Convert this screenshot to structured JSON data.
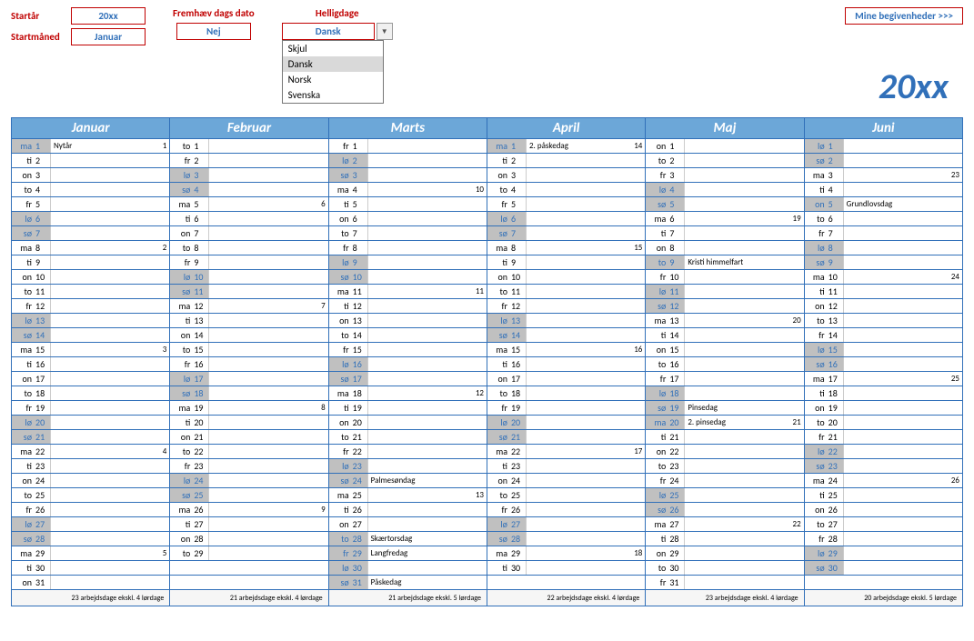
{
  "controls": {
    "start_year_label": "Startår",
    "start_year_value": "20xx",
    "start_month_label": "Startmåned",
    "start_month_value": "Januar",
    "highlight_label": "Fremhæv dags dato",
    "highlight_value": "Nej",
    "holidays_label": "Helligdage",
    "holidays_value": "Dansk",
    "holidays_options": [
      "Skjul",
      "Dansk",
      "Norsk",
      "Svenska"
    ],
    "holidays_selected_index": 1,
    "events_link": "Mine begivenheder >>>"
  },
  "year_display": "20xx",
  "months": [
    {
      "name": "Januar",
      "footer": "23 arbejdsdage ekskl. 4 lørdage",
      "days": [
        {
          "wd": "ma",
          "n": 1,
          "evt": "Nytår",
          "wk": 1,
          "hol": true
        },
        {
          "wd": "ti",
          "n": 2
        },
        {
          "wd": "on",
          "n": 3
        },
        {
          "wd": "to",
          "n": 4
        },
        {
          "wd": "fr",
          "n": 5
        },
        {
          "wd": "lø",
          "n": 6,
          "wknd": true
        },
        {
          "wd": "sø",
          "n": 7,
          "wknd": true
        },
        {
          "wd": "ma",
          "n": 8,
          "wk": 2
        },
        {
          "wd": "ti",
          "n": 9
        },
        {
          "wd": "on",
          "n": 10
        },
        {
          "wd": "to",
          "n": 11
        },
        {
          "wd": "fr",
          "n": 12
        },
        {
          "wd": "lø",
          "n": 13,
          "wknd": true
        },
        {
          "wd": "sø",
          "n": 14,
          "wknd": true
        },
        {
          "wd": "ma",
          "n": 15,
          "wk": 3
        },
        {
          "wd": "ti",
          "n": 16
        },
        {
          "wd": "on",
          "n": 17
        },
        {
          "wd": "to",
          "n": 18
        },
        {
          "wd": "fr",
          "n": 19
        },
        {
          "wd": "lø",
          "n": 20,
          "wknd": true
        },
        {
          "wd": "sø",
          "n": 21,
          "wknd": true
        },
        {
          "wd": "ma",
          "n": 22,
          "wk": 4
        },
        {
          "wd": "ti",
          "n": 23
        },
        {
          "wd": "on",
          "n": 24
        },
        {
          "wd": "to",
          "n": 25
        },
        {
          "wd": "fr",
          "n": 26
        },
        {
          "wd": "lø",
          "n": 27,
          "wknd": true
        },
        {
          "wd": "sø",
          "n": 28,
          "wknd": true
        },
        {
          "wd": "ma",
          "n": 29,
          "wk": 5
        },
        {
          "wd": "ti",
          "n": 30
        },
        {
          "wd": "on",
          "n": 31
        }
      ]
    },
    {
      "name": "Februar",
      "footer": "21 arbejdsdage ekskl. 4 lørdage",
      "days": [
        {
          "wd": "to",
          "n": 1
        },
        {
          "wd": "fr",
          "n": 2
        },
        {
          "wd": "lø",
          "n": 3,
          "wknd": true
        },
        {
          "wd": "sø",
          "n": 4,
          "wknd": true
        },
        {
          "wd": "ma",
          "n": 5,
          "wk": 6
        },
        {
          "wd": "ti",
          "n": 6
        },
        {
          "wd": "on",
          "n": 7
        },
        {
          "wd": "to",
          "n": 8
        },
        {
          "wd": "fr",
          "n": 9
        },
        {
          "wd": "lø",
          "n": 10,
          "wknd": true
        },
        {
          "wd": "sø",
          "n": 11,
          "wknd": true
        },
        {
          "wd": "ma",
          "n": 12,
          "wk": 7
        },
        {
          "wd": "ti",
          "n": 13
        },
        {
          "wd": "on",
          "n": 14
        },
        {
          "wd": "to",
          "n": 15
        },
        {
          "wd": "fr",
          "n": 16
        },
        {
          "wd": "lø",
          "n": 17,
          "wknd": true
        },
        {
          "wd": "sø",
          "n": 18,
          "wknd": true
        },
        {
          "wd": "ma",
          "n": 19,
          "wk": 8
        },
        {
          "wd": "ti",
          "n": 20
        },
        {
          "wd": "on",
          "n": 21
        },
        {
          "wd": "to",
          "n": 22
        },
        {
          "wd": "fr",
          "n": 23
        },
        {
          "wd": "lø",
          "n": 24,
          "wknd": true
        },
        {
          "wd": "sø",
          "n": 25,
          "wknd": true
        },
        {
          "wd": "ma",
          "n": 26,
          "wk": 9
        },
        {
          "wd": "ti",
          "n": 27
        },
        {
          "wd": "on",
          "n": 28
        },
        {
          "wd": "to",
          "n": 29
        }
      ]
    },
    {
      "name": "Marts",
      "footer": "21 arbejdsdage ekskl. 5 lørdage",
      "days": [
        {
          "wd": "fr",
          "n": 1
        },
        {
          "wd": "lø",
          "n": 2,
          "wknd": true
        },
        {
          "wd": "sø",
          "n": 3,
          "wknd": true
        },
        {
          "wd": "ma",
          "n": 4,
          "wk": 10
        },
        {
          "wd": "ti",
          "n": 5
        },
        {
          "wd": "on",
          "n": 6
        },
        {
          "wd": "to",
          "n": 7
        },
        {
          "wd": "fr",
          "n": 8
        },
        {
          "wd": "lø",
          "n": 9,
          "wknd": true
        },
        {
          "wd": "sø",
          "n": 10,
          "wknd": true
        },
        {
          "wd": "ma",
          "n": 11,
          "wk": 11
        },
        {
          "wd": "ti",
          "n": 12
        },
        {
          "wd": "on",
          "n": 13
        },
        {
          "wd": "to",
          "n": 14
        },
        {
          "wd": "fr",
          "n": 15
        },
        {
          "wd": "lø",
          "n": 16,
          "wknd": true
        },
        {
          "wd": "sø",
          "n": 17,
          "wknd": true
        },
        {
          "wd": "ma",
          "n": 18,
          "wk": 12
        },
        {
          "wd": "ti",
          "n": 19
        },
        {
          "wd": "on",
          "n": 20
        },
        {
          "wd": "to",
          "n": 21
        },
        {
          "wd": "fr",
          "n": 22
        },
        {
          "wd": "lø",
          "n": 23,
          "wknd": true
        },
        {
          "wd": "sø",
          "n": 24,
          "wknd": true,
          "evt": "Palmesøndag"
        },
        {
          "wd": "ma",
          "n": 25,
          "wk": 13
        },
        {
          "wd": "ti",
          "n": 26
        },
        {
          "wd": "on",
          "n": 27
        },
        {
          "wd": "to",
          "n": 28,
          "evt": "Skærtorsdag",
          "hol": true
        },
        {
          "wd": "fr",
          "n": 29,
          "evt": "Langfredag",
          "hol": true
        },
        {
          "wd": "lø",
          "n": 30,
          "wknd": true
        },
        {
          "wd": "sø",
          "n": 31,
          "wknd": true,
          "evt": "Påskedag"
        }
      ]
    },
    {
      "name": "April",
      "footer": "22 arbejdsdage ekskl. 4 lørdage",
      "days": [
        {
          "wd": "ma",
          "n": 1,
          "evt": "2. påskedag",
          "wk": 14,
          "hol": true
        },
        {
          "wd": "ti",
          "n": 2
        },
        {
          "wd": "on",
          "n": 3
        },
        {
          "wd": "to",
          "n": 4
        },
        {
          "wd": "fr",
          "n": 5
        },
        {
          "wd": "lø",
          "n": 6,
          "wknd": true
        },
        {
          "wd": "sø",
          "n": 7,
          "wknd": true
        },
        {
          "wd": "ma",
          "n": 8,
          "wk": 15
        },
        {
          "wd": "ti",
          "n": 9
        },
        {
          "wd": "on",
          "n": 10
        },
        {
          "wd": "to",
          "n": 11
        },
        {
          "wd": "fr",
          "n": 12
        },
        {
          "wd": "lø",
          "n": 13,
          "wknd": true
        },
        {
          "wd": "sø",
          "n": 14,
          "wknd": true
        },
        {
          "wd": "ma",
          "n": 15,
          "wk": 16
        },
        {
          "wd": "ti",
          "n": 16
        },
        {
          "wd": "on",
          "n": 17
        },
        {
          "wd": "to",
          "n": 18
        },
        {
          "wd": "fr",
          "n": 19
        },
        {
          "wd": "lø",
          "n": 20,
          "wknd": true
        },
        {
          "wd": "sø",
          "n": 21,
          "wknd": true
        },
        {
          "wd": "ma",
          "n": 22,
          "wk": 17
        },
        {
          "wd": "ti",
          "n": 23
        },
        {
          "wd": "on",
          "n": 24
        },
        {
          "wd": "to",
          "n": 25
        },
        {
          "wd": "fr",
          "n": 26
        },
        {
          "wd": "lø",
          "n": 27,
          "wknd": true
        },
        {
          "wd": "sø",
          "n": 28,
          "wknd": true
        },
        {
          "wd": "ma",
          "n": 29,
          "wk": 18
        },
        {
          "wd": "ti",
          "n": 30
        }
      ]
    },
    {
      "name": "Maj",
      "footer": "23 arbejdsdage ekskl. 4 lørdage",
      "days": [
        {
          "wd": "on",
          "n": 1
        },
        {
          "wd": "to",
          "n": 2
        },
        {
          "wd": "fr",
          "n": 3
        },
        {
          "wd": "lø",
          "n": 4,
          "wknd": true
        },
        {
          "wd": "sø",
          "n": 5,
          "wknd": true
        },
        {
          "wd": "ma",
          "n": 6,
          "wk": 19
        },
        {
          "wd": "ti",
          "n": 7
        },
        {
          "wd": "on",
          "n": 8
        },
        {
          "wd": "to",
          "n": 9,
          "evt": "Kristi himmelfart",
          "hol": true
        },
        {
          "wd": "fr",
          "n": 10
        },
        {
          "wd": "lø",
          "n": 11,
          "wknd": true
        },
        {
          "wd": "sø",
          "n": 12,
          "wknd": true
        },
        {
          "wd": "ma",
          "n": 13,
          "wk": 20
        },
        {
          "wd": "ti",
          "n": 14
        },
        {
          "wd": "on",
          "n": 15
        },
        {
          "wd": "to",
          "n": 16
        },
        {
          "wd": "fr",
          "n": 17
        },
        {
          "wd": "lø",
          "n": 18,
          "wknd": true
        },
        {
          "wd": "sø",
          "n": 19,
          "wknd": true,
          "evt": "Pinsedag"
        },
        {
          "wd": "ma",
          "n": 20,
          "evt": "2. pinsedag",
          "wk": 21,
          "hol": true
        },
        {
          "wd": "ti",
          "n": 21
        },
        {
          "wd": "on",
          "n": 22
        },
        {
          "wd": "to",
          "n": 23
        },
        {
          "wd": "fr",
          "n": 24
        },
        {
          "wd": "lø",
          "n": 25,
          "wknd": true
        },
        {
          "wd": "sø",
          "n": 26,
          "wknd": true
        },
        {
          "wd": "ma",
          "n": 27,
          "wk": 22
        },
        {
          "wd": "ti",
          "n": 28
        },
        {
          "wd": "on",
          "n": 29
        },
        {
          "wd": "to",
          "n": 30
        },
        {
          "wd": "fr",
          "n": 31
        }
      ]
    },
    {
      "name": "Juni",
      "footer": "20 arbejdsdage ekskl. 5 lørdage",
      "days": [
        {
          "wd": "lø",
          "n": 1,
          "wknd": true
        },
        {
          "wd": "sø",
          "n": 2,
          "wknd": true
        },
        {
          "wd": "ma",
          "n": 3,
          "wk": 23
        },
        {
          "wd": "ti",
          "n": 4
        },
        {
          "wd": "on",
          "n": 5,
          "evt": "Grundlovsdag",
          "hol": true
        },
        {
          "wd": "to",
          "n": 6
        },
        {
          "wd": "fr",
          "n": 7
        },
        {
          "wd": "lø",
          "n": 8,
          "wknd": true
        },
        {
          "wd": "sø",
          "n": 9,
          "wknd": true
        },
        {
          "wd": "ma",
          "n": 10,
          "wk": 24
        },
        {
          "wd": "ti",
          "n": 11
        },
        {
          "wd": "on",
          "n": 12
        },
        {
          "wd": "to",
          "n": 13
        },
        {
          "wd": "fr",
          "n": 14
        },
        {
          "wd": "lø",
          "n": 15,
          "wknd": true
        },
        {
          "wd": "sø",
          "n": 16,
          "wknd": true
        },
        {
          "wd": "ma",
          "n": 17,
          "wk": 25
        },
        {
          "wd": "ti",
          "n": 18
        },
        {
          "wd": "on",
          "n": 19
        },
        {
          "wd": "to",
          "n": 20
        },
        {
          "wd": "fr",
          "n": 21
        },
        {
          "wd": "lø",
          "n": 22,
          "wknd": true
        },
        {
          "wd": "sø",
          "n": 23,
          "wknd": true
        },
        {
          "wd": "ma",
          "n": 24,
          "wk": 26
        },
        {
          "wd": "ti",
          "n": 25
        },
        {
          "wd": "on",
          "n": 26
        },
        {
          "wd": "to",
          "n": 27
        },
        {
          "wd": "fr",
          "n": 28
        },
        {
          "wd": "lø",
          "n": 29,
          "wknd": true
        },
        {
          "wd": "sø",
          "n": 30,
          "wknd": true
        }
      ]
    }
  ]
}
